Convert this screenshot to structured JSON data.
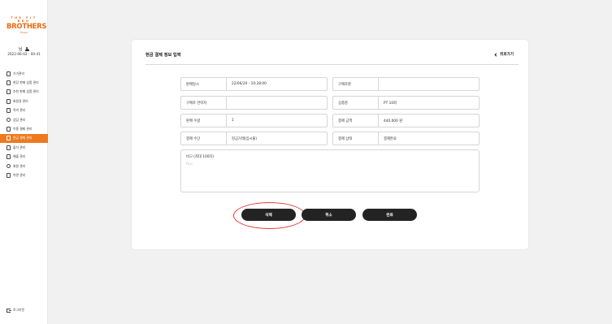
{
  "sidebar": {
    "logo_top": "THE FIT BRO",
    "logo_main": "BROTHERS",
    "logo_sub": "fitness",
    "user_name": "님",
    "date": "2022-06-02 - 00:41",
    "items": [
      {
        "label": "기기관리",
        "icon": "device-icon"
      },
      {
        "label": "현장 판매 상품 관리",
        "icon": "store-icon"
      },
      {
        "label": "추천 판매 상품 관리",
        "icon": "box-icon"
      },
      {
        "label": "회원권 관리",
        "icon": "ticket-icon"
      },
      {
        "label": "락커 관리",
        "icon": "locker-icon"
      },
      {
        "label": "상담 관리",
        "icon": "person-icon"
      },
      {
        "label": "이용 결제 관리",
        "icon": "card-icon"
      },
      {
        "label": "현금 결제 관리",
        "icon": "cash-icon",
        "active": true
      },
      {
        "label": "출석 관리",
        "icon": "check-icon"
      },
      {
        "label": "매출 관리",
        "icon": "chart-icon"
      },
      {
        "label": "회원 관리",
        "icon": "gear-icon"
      },
      {
        "label": "약관 관리",
        "icon": "document-icon"
      }
    ],
    "logout_label": "로그아웃"
  },
  "card": {
    "title": "현금 결제 정보 입력",
    "back_label": "뒤로가기"
  },
  "form": {
    "left": [
      {
        "label": "판매일시",
        "value": "22/06/20 - 10:28:00"
      },
      {
        "label": "구매자 연락처",
        "value": ""
      },
      {
        "label": "판매 수량",
        "value": "1"
      },
      {
        "label": "결제 수단",
        "value": "현금거래(임시불)"
      }
    ],
    "right": [
      {
        "label": "구매자명",
        "value": ""
      },
      {
        "label": "상품명",
        "value": "PT 10회"
      },
      {
        "label": "결제 금액",
        "value": "440,000 원"
      },
      {
        "label": "결제 상태",
        "value": "결제완료"
      }
    ],
    "memo_label": "비고 (최대 100자)",
    "memo_placeholder": "비고"
  },
  "buttons": {
    "delete": "삭제",
    "cancel": "취소",
    "done": "완료"
  },
  "colors": {
    "accent": "#ee7a1f",
    "button": "#232323",
    "highlight": "#e53935"
  }
}
